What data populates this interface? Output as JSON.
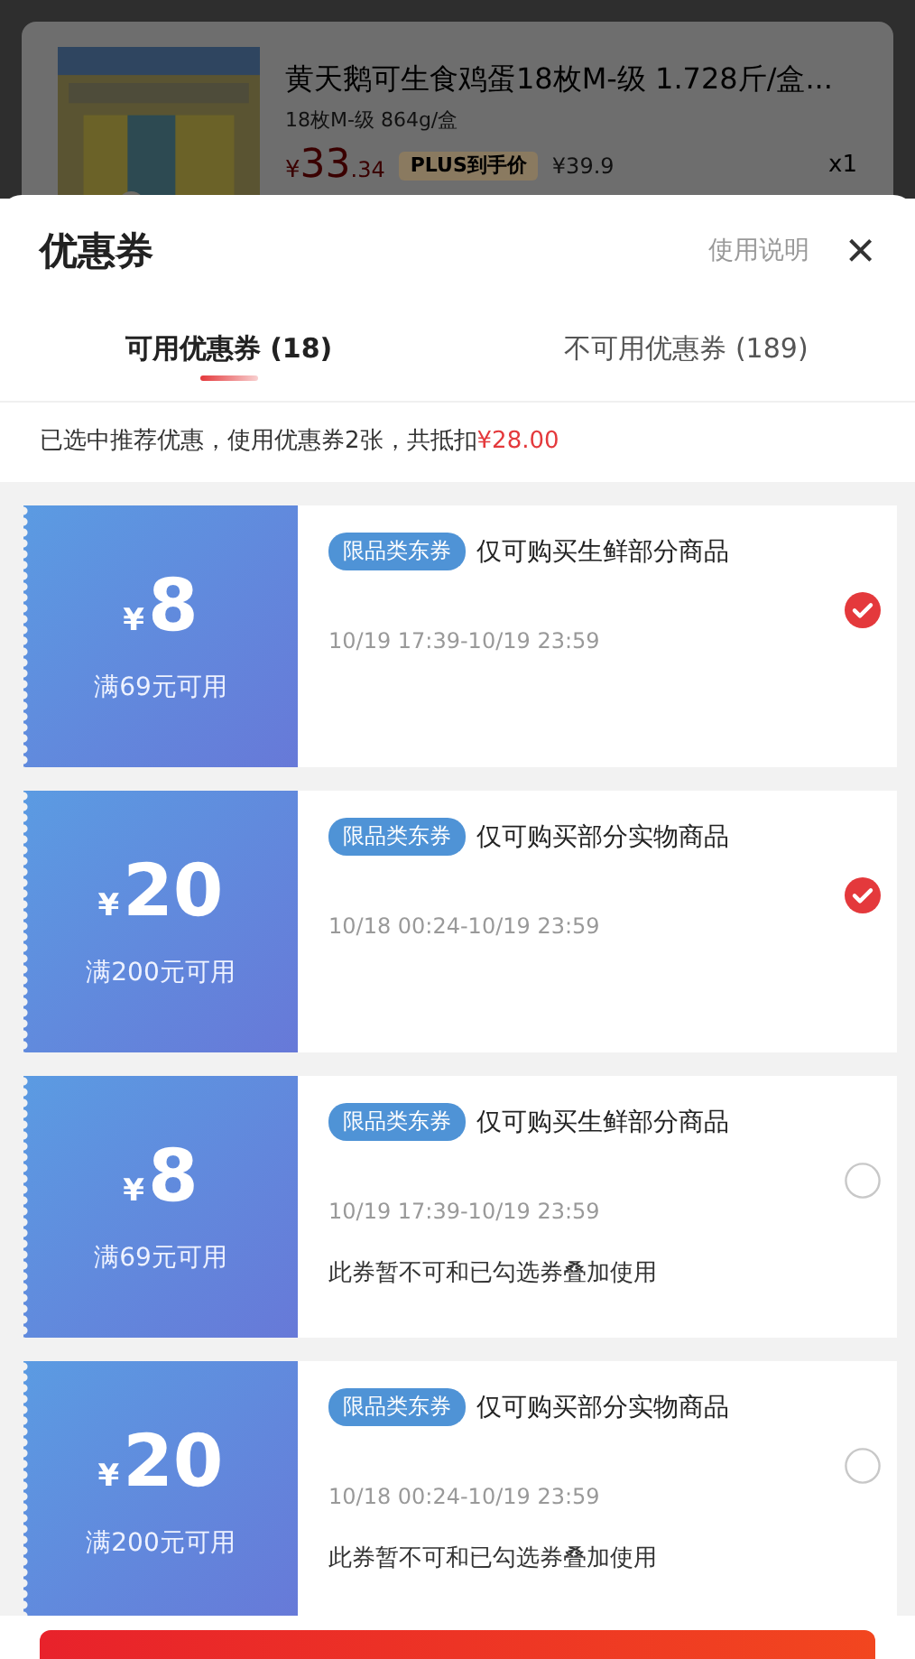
{
  "product": {
    "title": "黄天鹅可生食鸡蛋18枚M-级 1.728斤/盒...",
    "spec": "18枚M-级 864g/盒",
    "price_symbol": "¥",
    "price_int": "33",
    "price_dec": ".34",
    "plus_label": "PLUS到手价",
    "original_price": "¥39.9",
    "quantity": "x1"
  },
  "sheet": {
    "title": "优惠券",
    "help_link": "使用说明",
    "close": "×"
  },
  "tabs": [
    {
      "label": "可用优惠券 (18)",
      "selected": true
    },
    {
      "label": "不可用优惠券 (189)",
      "selected": false
    }
  ],
  "summary": {
    "text": "已选中推荐优惠，使用优惠券2张，共抵扣",
    "amount": "¥28.00"
  },
  "coupons": [
    {
      "currency": "¥",
      "amount": "8",
      "condition": "满69元可用",
      "tag": "限品类东券",
      "scope": "仅可购买生鲜部分商品",
      "time": "10/19 17:39-10/19 23:59",
      "selected": true
    },
    {
      "currency": "¥",
      "amount": "20",
      "condition": "满200元可用",
      "tag": "限品类东券",
      "scope": "仅可购买部分实物商品",
      "time": "10/18 00:24-10/19 23:59",
      "selected": true
    },
    {
      "currency": "¥",
      "amount": "8",
      "condition": "满69元可用",
      "tag": "限品类东券",
      "scope": "仅可购买生鲜部分商品",
      "time": "10/19 17:39-10/19 23:59",
      "note": "此券暂不可和已勾选券叠加使用",
      "selected": false
    },
    {
      "currency": "¥",
      "amount": "20",
      "condition": "满200元可用",
      "tag": "限品类东券",
      "scope": "仅可购买部分实物商品",
      "time": "10/18 00:24-10/19 23:59",
      "note": "此券暂不可和已勾选券叠加使用",
      "selected": false
    }
  ]
}
